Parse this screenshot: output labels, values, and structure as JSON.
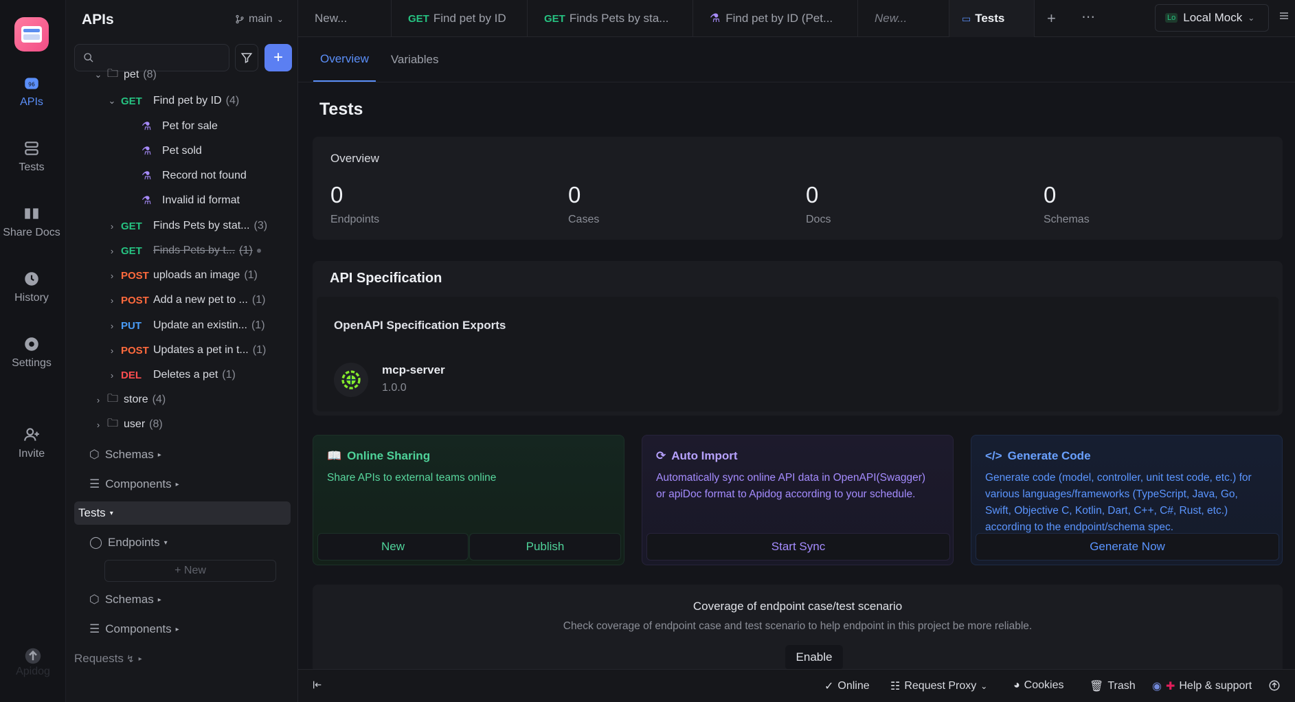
{
  "rail": {
    "items": [
      {
        "label": "APIs",
        "icon": "apis-icon",
        "active": true
      },
      {
        "label": "Tests",
        "icon": "tests-icon"
      },
      {
        "label": "Share Docs",
        "icon": "share-docs-icon"
      },
      {
        "label": "History",
        "icon": "history-icon"
      },
      {
        "label": "Settings",
        "icon": "settings-icon"
      },
      {
        "label": "Invite",
        "icon": "invite-icon"
      }
    ],
    "footer_label": "Apidog"
  },
  "sidebar": {
    "title": "APIs",
    "branch": "main",
    "tree": {
      "pet_folder": {
        "label": "pet",
        "count": "(8)"
      },
      "find_pet": {
        "method": "GET",
        "label": "Find pet by ID",
        "count": "(4)"
      },
      "cases": [
        "Pet for sale",
        "Pet sold",
        "Record not found",
        "Invalid id format"
      ],
      "endpoints": [
        {
          "method": "GET",
          "label": "Finds Pets by stat...",
          "count": "(3)"
        },
        {
          "method": "GET",
          "label": "Finds Pets by t...",
          "count": "(1)",
          "deprecated": true
        },
        {
          "method": "POST",
          "label": "uploads an image",
          "count": "(1)"
        },
        {
          "method": "POST",
          "label": "Add a new pet to ...",
          "count": "(1)"
        },
        {
          "method": "PUT",
          "label": "Update an existin...",
          "count": "(1)"
        },
        {
          "method": "POST",
          "label": "Updates a pet in t...",
          "count": "(1)"
        },
        {
          "method": "DEL",
          "label": "Deletes a pet",
          "count": "(1)"
        }
      ],
      "store_folder": {
        "label": "store",
        "count": "(4)"
      },
      "user_folder": {
        "label": "user",
        "count": "(8)"
      }
    },
    "schemas_label": "Schemas",
    "components_label": "Components",
    "tests_label": "Tests",
    "tests_endpoints_label": "Endpoints",
    "tests_new_label": "+ New",
    "tests_schemas_label": "Schemas",
    "tests_components_label": "Components",
    "requests_label": "Requests"
  },
  "tabs": [
    {
      "label": "New...",
      "italic": false
    },
    {
      "method": "GET",
      "label": "Find pet by ID"
    },
    {
      "method": "GET",
      "label": "Finds Pets by sta..."
    },
    {
      "label": "Find pet by ID (Pet..."
    },
    {
      "label": "New...",
      "italic": true
    },
    {
      "label": "Tests",
      "active": true
    }
  ],
  "environment": {
    "badge": "Lo",
    "label": "Local Mock"
  },
  "main": {
    "subtabs": [
      "Overview",
      "Variables"
    ],
    "title": "Tests",
    "overview": {
      "title": "Overview",
      "stats": [
        {
          "value": "0",
          "label": "Endpoints"
        },
        {
          "value": "0",
          "label": "Cases"
        },
        {
          "value": "0",
          "label": "Docs"
        },
        {
          "value": "0",
          "label": "Schemas"
        }
      ]
    },
    "spec": {
      "title": "API Specification",
      "subtitle": "OpenAPI Specification Exports",
      "item_name": "mcp-server",
      "item_version": "1.0.0"
    },
    "features": {
      "sharing": {
        "title": "Online Sharing",
        "desc": "Share APIs to external teams online",
        "btn_new": "New",
        "btn_publish": "Publish"
      },
      "import": {
        "title": "Auto Import",
        "desc": "Automatically sync online API data in OpenAPI(Swagger) or apiDoc format to Apidog according to your schedule.",
        "btn": "Start Sync"
      },
      "generate": {
        "title": "Generate Code",
        "desc": "Generate code (model, controller, unit test code, etc.) for various languages/frameworks (TypeScript, Java, Go, Swift, Objective C, Kotlin, Dart, C++, C#, Rust, etc.) according to the endpoint/schema spec.",
        "btn": "Generate Now"
      }
    },
    "coverage": {
      "title": "Coverage of endpoint case/test scenario",
      "desc": "Check coverage of endpoint case and test scenario to help endpoint in this project be more reliable.",
      "btn": "Enable"
    }
  },
  "statusbar": {
    "online": "Online",
    "proxy": "Request Proxy",
    "cookies": "Cookies",
    "trash": "Trash",
    "help": "Help & support"
  }
}
